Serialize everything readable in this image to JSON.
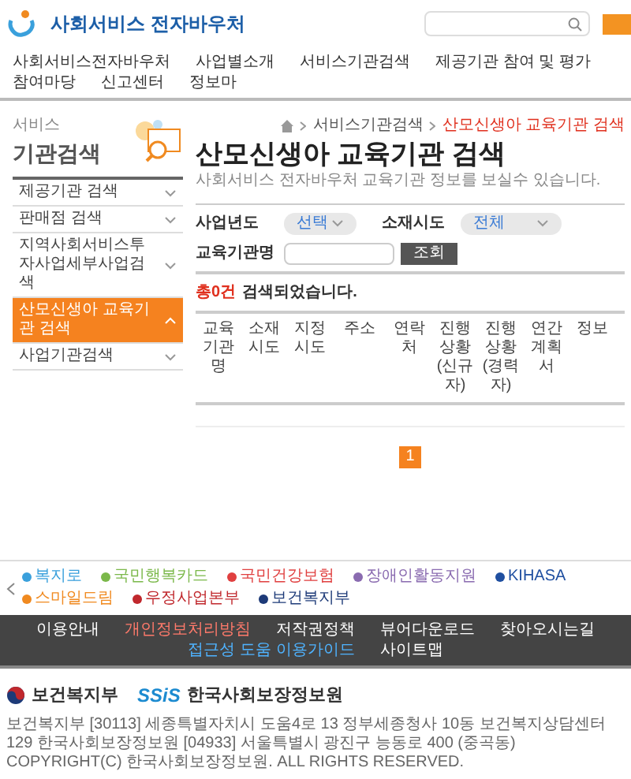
{
  "header": {
    "logo": "사회서비스 전자바우처"
  },
  "nav": [
    "사회서비스전자바우처",
    "사업별소개",
    "서비스기관검색",
    "제공기관 참여 및 평가",
    "참여마당",
    "신고센터",
    "정보마"
  ],
  "sidebar": {
    "title_small": "서비스",
    "title": "기관검색",
    "items": [
      {
        "label": "제공기관 검색",
        "selected": false
      },
      {
        "label": "판매점 검색",
        "selected": false
      },
      {
        "label": "지역사회서비스투자사업세부사업검색",
        "selected": false
      },
      {
        "label": "산모신생아 교육기관 검색",
        "selected": true
      },
      {
        "label": "사업기관검색",
        "selected": false
      }
    ]
  },
  "breadcrumb": [
    "서비스기관검색",
    "산모신생아 교육기관 검색"
  ],
  "page_title": "산모신생아 교육기관 검색",
  "subtitle": "사회서비스 전자바우처 교육기관 정보를 보실수 있습니다.",
  "form": {
    "year": {
      "label": "사업년도",
      "value": "선택"
    },
    "region": {
      "label": "소재시도",
      "value": "전체"
    },
    "name": {
      "label": "교육기관명"
    },
    "button": "조회"
  },
  "result": {
    "count": "총0건",
    "text": "검색되었습니다."
  },
  "table": {
    "columns": [
      "교육기관명",
      "소재시도",
      "지정시도",
      "주소",
      "연락처",
      "진행상황 (신규자)",
      "진행상황 (경력자)",
      "연간계획서",
      "정보"
    ]
  },
  "pagination": [
    {
      "label": "1",
      "selected": true
    }
  ],
  "partners": [
    {
      "label": "복지로",
      "color": "#3aa0dc"
    },
    {
      "label": "국민행복카드",
      "color": "#7bb84a"
    },
    {
      "label": "국민건강보험",
      "color": "#e04040"
    },
    {
      "label": "장애인활동지원",
      "color": "#8a6bb0"
    },
    {
      "label": "KIHASA",
      "color": "#1f4fa0"
    },
    {
      "label": "스마일드림",
      "color": "#f08a20"
    },
    {
      "label": "우정사업본부",
      "color": "#c0282d"
    },
    {
      "label": "보건복지부",
      "color": "#1d3a78"
    }
  ],
  "footer_nav": [
    {
      "label": "이용안내",
      "kind": "normal"
    },
    {
      "label": "개인정보처리방침",
      "kind": "privacy"
    },
    {
      "label": "저작권정책",
      "kind": "normal"
    },
    {
      "label": "뷰어다운로드",
      "kind": "normal"
    },
    {
      "label": "찾아오시는길",
      "kind": "normal"
    },
    {
      "label": "접근성 도움 이용가이드",
      "kind": "access"
    },
    {
      "label": "사이트맵",
      "kind": "normal"
    }
  ],
  "footer": {
    "orgs": [
      "보건복지부",
      "한국사회보장정보원"
    ],
    "ssis": "SSiS",
    "address": "보건복지부 [30113] 세종특별자치시 도움4로 13 정부세종청사 10동 보건복지상담센터 129 한국사회보장정보원 [04933] 서울특별시 광진구 능동로 400 (중곡동) COPYRIGHT(C) 한국사회보장정보원. ALL RIGHTS RESERVED."
  }
}
